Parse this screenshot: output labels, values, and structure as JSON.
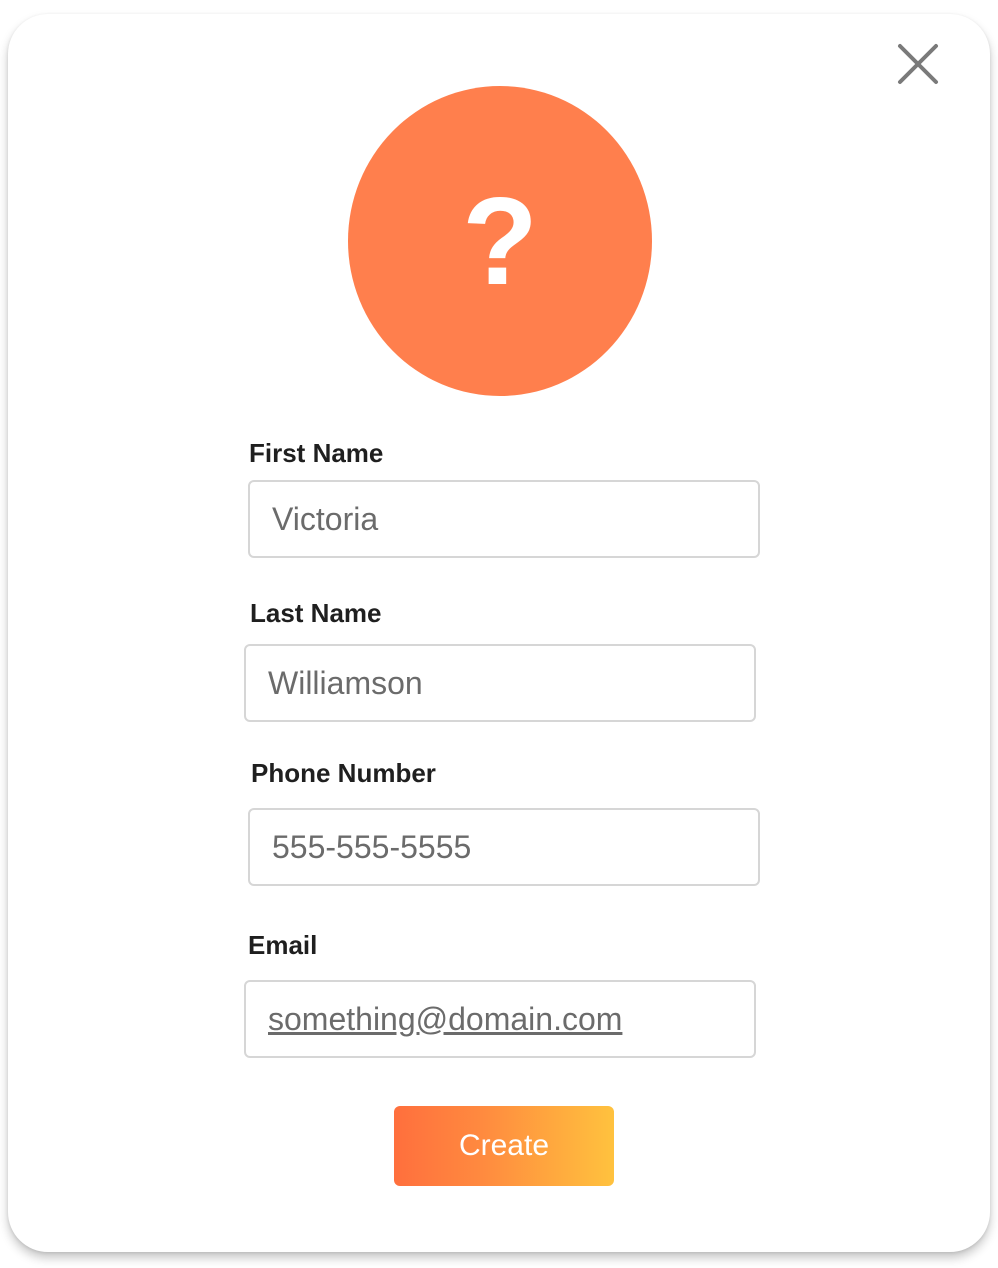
{
  "dialog": {
    "close_icon": "close-icon",
    "avatar": {
      "icon": "question-mark-icon",
      "glyph": "?",
      "color": "#ff7f4d"
    },
    "form": {
      "first_name": {
        "label": "First Name",
        "placeholder": "Victoria"
      },
      "last_name": {
        "label": "Last Name",
        "placeholder": "Williamson"
      },
      "phone": {
        "label": "Phone Number",
        "placeholder": "555-555-5555"
      },
      "email": {
        "label": "Email",
        "placeholder": "something@domain.com"
      }
    },
    "create_button": {
      "label": "Create",
      "gradient": [
        "#ff6f3d",
        "#ffc23e"
      ]
    }
  }
}
